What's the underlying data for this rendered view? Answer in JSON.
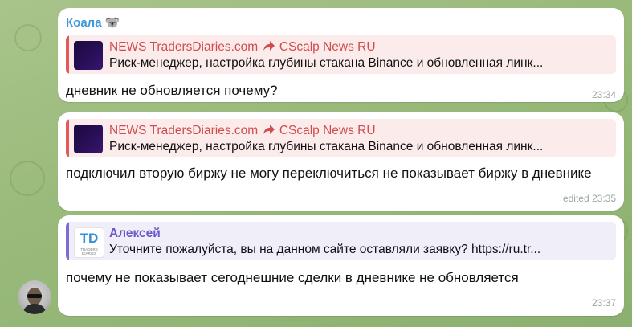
{
  "messages": [
    {
      "sender": "Коала",
      "sender_emoji": "🐨",
      "reply": {
        "channel": "NEWS TradersDiaries.com",
        "forward_icon": "forward-arrow-icon",
        "forwarded_from": "CScalp News RU",
        "preview": "Риск-менеджер, настройка глубины стакана Binance и обновленная линк..."
      },
      "text": "дневник не обновляется почему?",
      "time": "23:34"
    },
    {
      "reply": {
        "channel": "NEWS TradersDiaries.com",
        "forward_icon": "forward-arrow-icon",
        "forwarded_from": "CScalp News RU",
        "preview": "Риск-менеджер, настройка глубины стакана Binance и обновленная линк..."
      },
      "text": "подключил вторую биржу не могу переключиться не показывает биржу в дневнике",
      "time": "edited 23:35"
    },
    {
      "reply": {
        "author": "Алексей",
        "preview": "Уточните пожалуйста, вы на данном сайте оставляли заявку? https://ru.tr...",
        "logo_text": "TD",
        "logo_caption": "TRADERS DIARIES"
      },
      "text": "почему не показывает сегоднешние сделки в дневнике не обновляется",
      "time": "23:37"
    }
  ],
  "colors": {
    "background": "#98b979",
    "bubble": "#ffffff",
    "sender": "#3e9ad8",
    "channel_reply": "#d24c4c",
    "user_reply": "#6a57c8"
  }
}
